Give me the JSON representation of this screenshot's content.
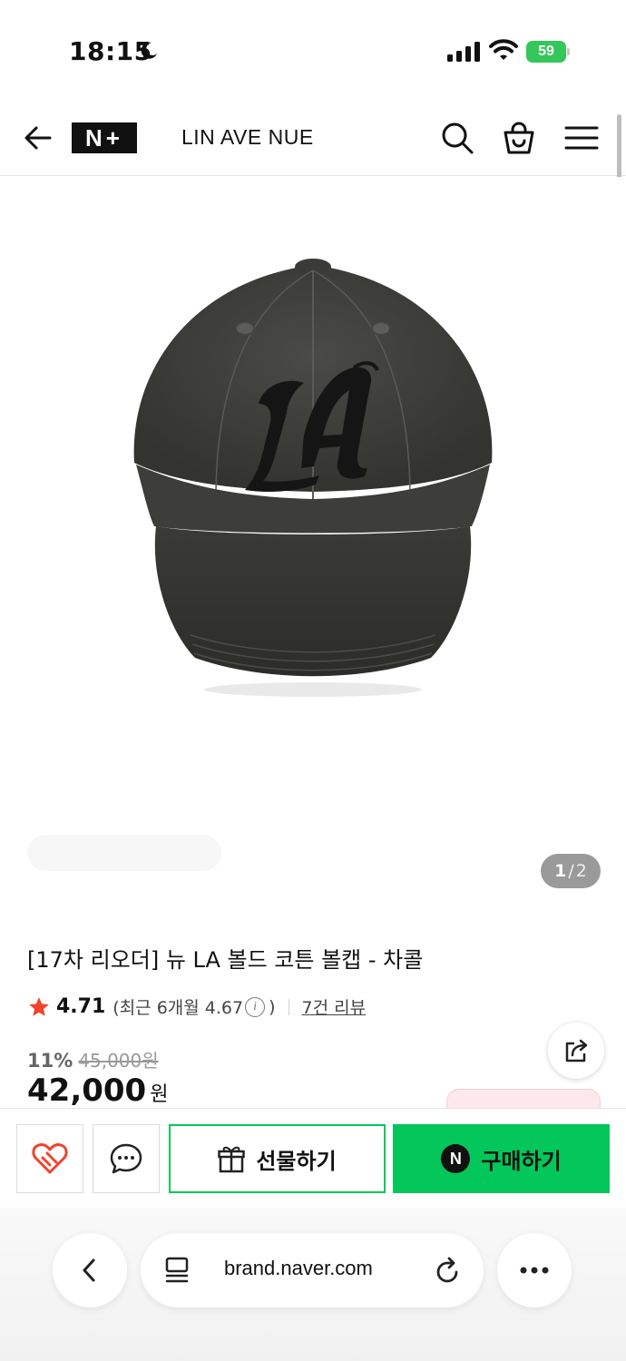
{
  "status_bar": {
    "time": "18:15",
    "battery": "59"
  },
  "header": {
    "brand": "LIN AVE NUE",
    "logo": "N+"
  },
  "gallery": {
    "counter_current": "1",
    "counter_separator": "/",
    "counter_total": "2"
  },
  "product": {
    "title": "[17차 리오더] 뉴 LA 볼드 코튼 볼캡 - 차콜",
    "rating": "4.71",
    "recent_prefix": "(최근 6개월 4.67",
    "recent_suffix": ")",
    "reviews": "7건 리뷰",
    "discount": "11%",
    "original_price": "45,000원",
    "price": "42,000",
    "price_unit": "원"
  },
  "actions": {
    "gift_label": "선물하기",
    "buy_label": "구매하기",
    "buy_badge": "N"
  },
  "browser": {
    "url": "brand.naver.com"
  },
  "colors": {
    "naver_green": "#03c75a",
    "star": "#f0442c",
    "wish_red": "#f0442c"
  },
  "icons": [
    "back-arrow-icon",
    "search-icon",
    "shopping-bag-icon",
    "menu-icon",
    "star-icon",
    "info-icon",
    "share-icon",
    "heart-link-icon",
    "chat-bubble-icon",
    "gift-icon",
    "chevron-left-icon",
    "tabs-icon",
    "reload-icon",
    "more-icon"
  ]
}
